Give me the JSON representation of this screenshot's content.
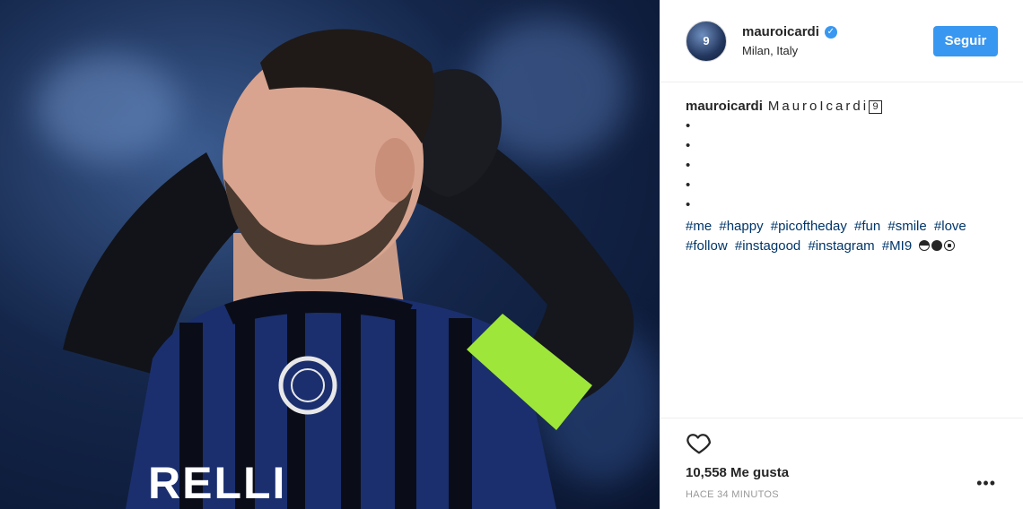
{
  "post": {
    "image_alt": "Football player in blue and black striped jersey holding hands on head",
    "jersey_text": "RELLI",
    "header": {
      "username": "mauroicardi",
      "verified": true,
      "location": "Milan, Italy",
      "follow_label": "Seguir",
      "avatar_badge": "9"
    },
    "caption": {
      "username": "mauroicardi",
      "name": "MauroIcardi",
      "badge": "9",
      "bullets": [
        "•",
        "•",
        "•",
        "•",
        "•"
      ],
      "hashtags_line1": [
        "#me",
        "#happy",
        "#picoftheday",
        "#fun",
        "#smile",
        "#love"
      ],
      "hashtags_line2": [
        "#follow",
        "#instagood",
        "#instagram",
        "#MI9"
      ],
      "emoji_icons": [
        "half-ball-emoji",
        "black-circle-emoji",
        "soccer-ball-emoji"
      ]
    },
    "footer": {
      "likes": "10,558 Me gusta",
      "timestamp": "HACE 34 MINUTOS",
      "more_label": "•••"
    }
  },
  "colors": {
    "accent": "#3897f0",
    "hashtag": "#003569",
    "text": "#262626",
    "muted": "#999999"
  }
}
